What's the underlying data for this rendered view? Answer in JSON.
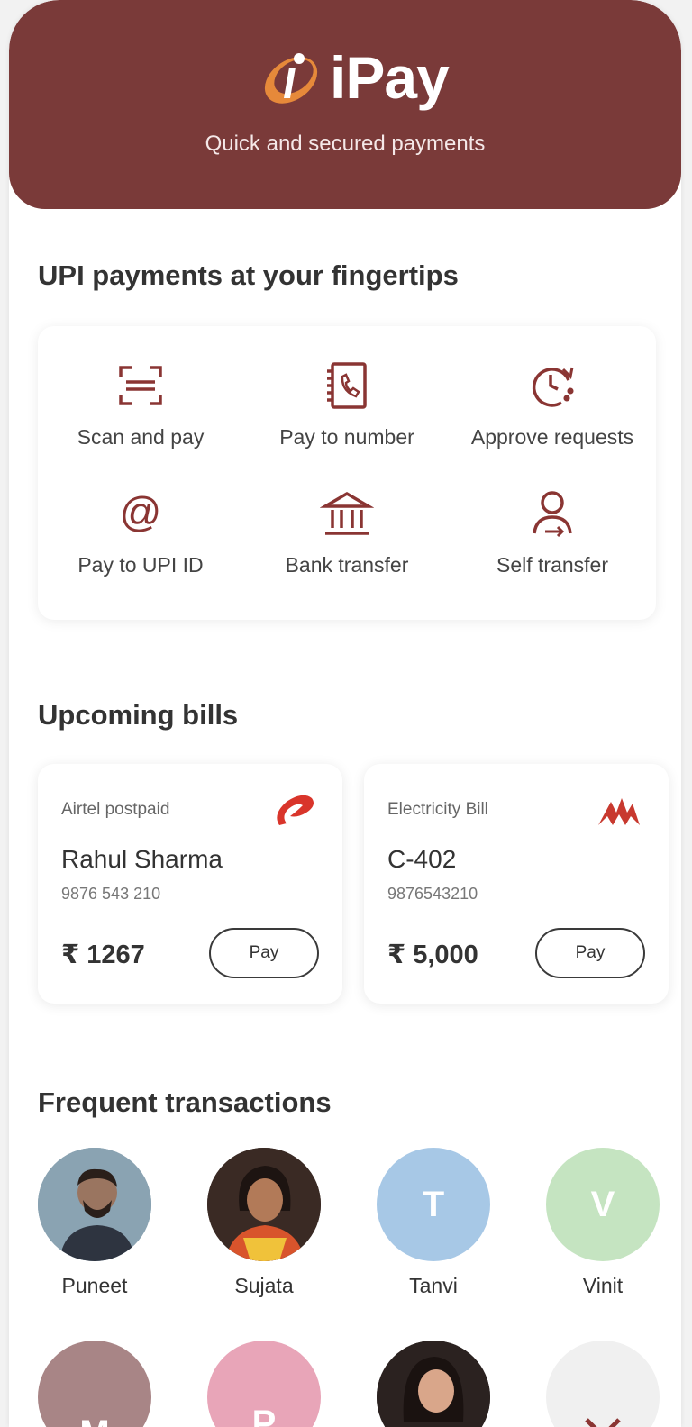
{
  "header": {
    "app_name": "iPay",
    "tagline": "Quick and secured payments",
    "color": "#7a3a39"
  },
  "upi": {
    "title": "UPI payments at your fingertips",
    "actions": [
      {
        "label": "Scan and pay",
        "icon": "scan-icon"
      },
      {
        "label": "Pay to number",
        "icon": "phone-book-icon"
      },
      {
        "label": "Approve requests",
        "icon": "clock-refresh-icon"
      },
      {
        "label": "Pay to UPI ID",
        "icon": "at-icon"
      },
      {
        "label": "Bank transfer",
        "icon": "bank-icon"
      },
      {
        "label": "Self transfer",
        "icon": "person-transfer-icon"
      }
    ]
  },
  "bills": {
    "title": "Upcoming bills",
    "items": [
      {
        "provider": "Airtel postpaid",
        "name": "Rahul Sharma",
        "number": "9876 543 210",
        "amount": "₹ 1267",
        "pay_label": "Pay",
        "logo": "airtel-logo"
      },
      {
        "provider": "Electricity Bill",
        "name": "C-402",
        "number": "9876543210",
        "amount": "₹ 5,000",
        "pay_label": "Pay",
        "logo": "electricity-logo"
      }
    ]
  },
  "frequent": {
    "title": "Frequent transactions",
    "contacts": [
      {
        "name": "Puneet",
        "initial": "",
        "color": "#6f8da0"
      },
      {
        "name": "Sujata",
        "initial": "",
        "color": "#3a2a24"
      },
      {
        "name": "Tanvi",
        "initial": "T",
        "color": "#a7c8e6"
      },
      {
        "name": "Vinit",
        "initial": "V",
        "color": "#c5e4c1"
      },
      {
        "name": "",
        "initial": "M",
        "color": "#a88586"
      },
      {
        "name": "",
        "initial": "P",
        "color": "#e8a5b8"
      },
      {
        "name": "",
        "initial": "",
        "color": "#2b2220"
      },
      {
        "name": "",
        "initial": "",
        "color": "#f0f0f0"
      }
    ]
  },
  "accent_color": "#8a3533"
}
